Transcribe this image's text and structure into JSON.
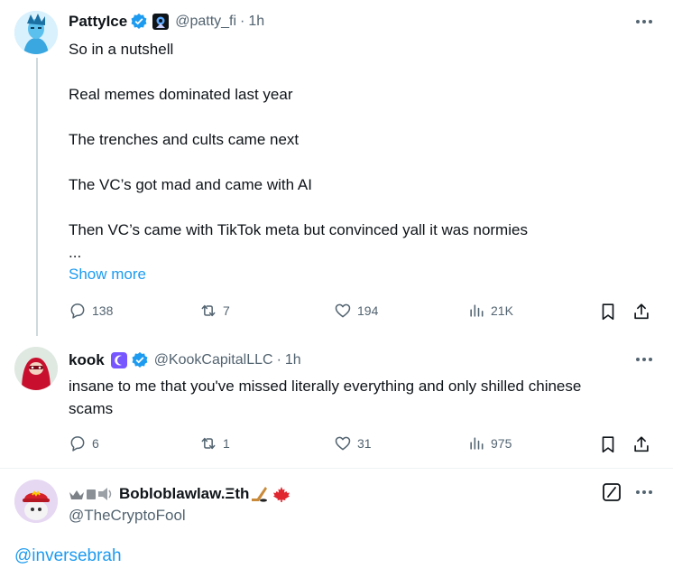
{
  "tweets": [
    {
      "name": "PattyIce",
      "handle": "@patty_fi",
      "time": "1h",
      "text": "So in a nutshell\n\nReal memes dominated last year\n\nThe trenches and cults came next\n\nThe VC’s got mad and came with AI\n\nThen VC’s came with TikTok meta but convinced yall it was normies\n...",
      "show_more": "Show more",
      "stats": {
        "replies": "138",
        "reposts": "7",
        "likes": "194",
        "views": "21K"
      }
    },
    {
      "name": "kook",
      "handle": "@KookCapitalLLC",
      "time": "1h",
      "text": "insane to me that you've missed literally everything and only shilled chinese\nscams",
      "stats": {
        "replies": "6",
        "reposts": "1",
        "likes": "31",
        "views": "975"
      }
    }
  ],
  "reply": {
    "name": "Bobloblawlaw.Ξth",
    "handle": "@TheCryptoFool",
    "mention": "@inversebrah"
  },
  "colors": {
    "accent": "#1d9bf0",
    "muted": "#536471",
    "verified_blue": "#1d9bf0",
    "badge_purple": "#7856ff"
  },
  "icons": [
    "verified-badge-icon",
    "more-icon",
    "reply-icon",
    "repost-icon",
    "like-icon",
    "views-icon",
    "bookmark-icon",
    "share-icon",
    "edit-icon",
    "flag-canada-icon"
  ]
}
